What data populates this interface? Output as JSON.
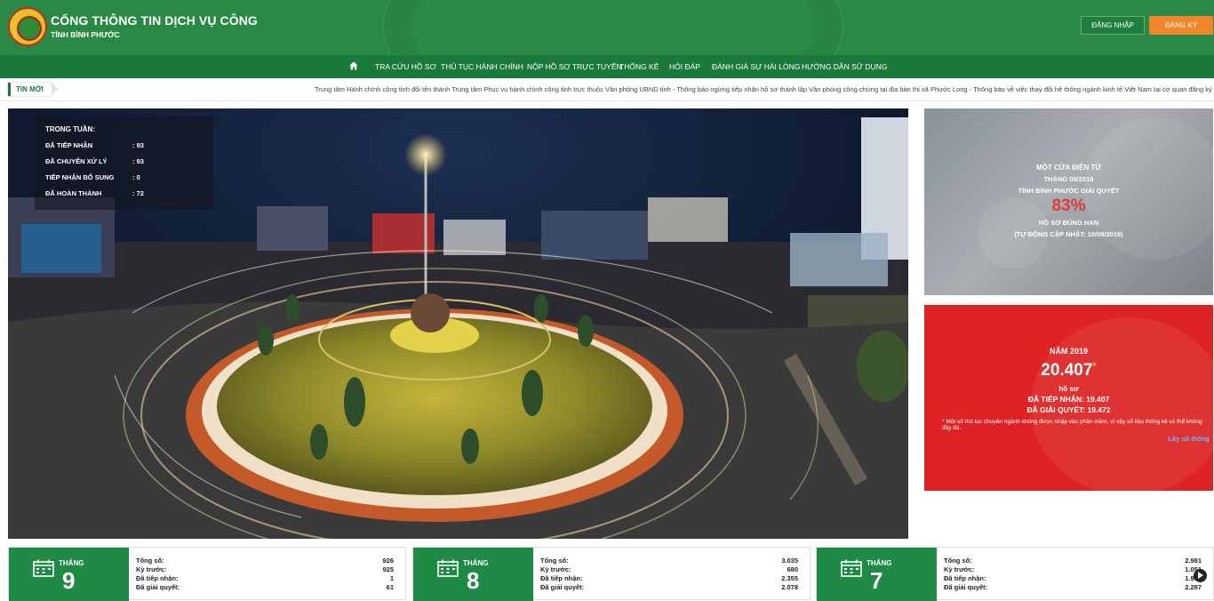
{
  "header": {
    "title": "CỔNG THÔNG TIN DỊCH VỤ CÔNG",
    "subtitle": "TỈNH BÌNH PHƯỚC",
    "login_label": "ĐĂNG NHẬP",
    "register_label": "ĐĂNG KÝ",
    "colors": {
      "brand_green": "#2a8a45",
      "register_orange": "#f0852a"
    }
  },
  "nav": {
    "home_icon": "home-icon",
    "items": [
      {
        "label": "TRA CỨU HỒ SƠ"
      },
      {
        "label": "THỦ TỤC HÀNH CHÍNH"
      },
      {
        "label": "NỘP HỒ SƠ TRỰC TUYẾN"
      },
      {
        "label": "THỐNG KÊ"
      },
      {
        "label": "HỎI ĐÁP"
      },
      {
        "label": "ĐÁNH GIÁ SỰ HÀI LÒNG"
      },
      {
        "label": "HƯỚNG DẪN SỬ DỤNG"
      }
    ]
  },
  "news": {
    "tag": "TIN MỚI",
    "ticker": "Trung tâm Hành chính công tỉnh đổi tên thành Trung tâm Phục vụ hành chính công tỉnh trực thuộc Văn phòng UBND tỉnh - Thông báo ngừng tiếp nhận hồ sơ thành lập Văn phòng công chứng tại địa bàn thị xã Phước Long - Thông báo về việc thay đổi hệ thống ngành kinh tế Việt Nam tại cơ quan đăng ký kinh"
  },
  "weekly_stats": {
    "title": "TRONG TUẦN:",
    "rows": [
      {
        "label": "ĐÃ TIẾP NHẬN",
        "value": ": 93"
      },
      {
        "label": "ĐÃ CHUYỂN XỬ LÝ",
        "value": ": 93"
      },
      {
        "label": "TIẾP NHẬN BỔ SUNG",
        "value": ": 0"
      },
      {
        "label": "ĐÃ HOÀN THÀNH",
        "value": ": 72"
      }
    ]
  },
  "one_stop": {
    "line1": "MỘT CỬA ĐIỆN TỬ",
    "line2": "THÁNG 09/2019",
    "line3": "TỈNH BÌNH PHƯỚC GIẢI QUYẾT",
    "percent": "83%",
    "line4": "HỒ SƠ ĐÚNG HẠN",
    "line5": "(TỰ ĐỘNG CẬP NHẬT: 10/09/2019)"
  },
  "year_panel": {
    "title": "NĂM 2019",
    "total": "20.407",
    "asterisk": "*",
    "unit": "hồ sơ",
    "received": "ĐÃ TIẾP NHẬN: 19.407",
    "resolved": "ĐÃ GIẢI QUYẾT: 19.472",
    "note": "* Một số thủ tục chuyên ngành không được nhập vào phần mềm, vì vậy số liệu thống kê có thể không đầy đủ.",
    "link": "Lấy số thống"
  },
  "months": [
    {
      "label": "THÁNG",
      "num": "9",
      "rows": [
        {
          "k": "Tổng số:",
          "v": "926"
        },
        {
          "k": "Kỳ trước:",
          "v": "925"
        },
        {
          "k": "Đã tiếp nhận:",
          "v": "1"
        },
        {
          "k": "Đã giải quyết:",
          "v": "61"
        }
      ]
    },
    {
      "label": "THÁNG",
      "num": "8",
      "rows": [
        {
          "k": "Tổng số:",
          "v": "3.035"
        },
        {
          "k": "Kỳ trước:",
          "v": "680"
        },
        {
          "k": "Đã tiếp nhận:",
          "v": "2.355"
        },
        {
          "k": "Đã giải quyết:",
          "v": "2.078"
        }
      ]
    },
    {
      "label": "THÁNG",
      "num": "7",
      "rows": [
        {
          "k": "Tổng số:",
          "v": "2.981"
        },
        {
          "k": "Kỳ trước:",
          "v": "1.051"
        },
        {
          "k": "Đã tiếp nhận:",
          "v": "1.930"
        },
        {
          "k": "Đã giải quyết:",
          "v": "2.287"
        }
      ]
    }
  ]
}
